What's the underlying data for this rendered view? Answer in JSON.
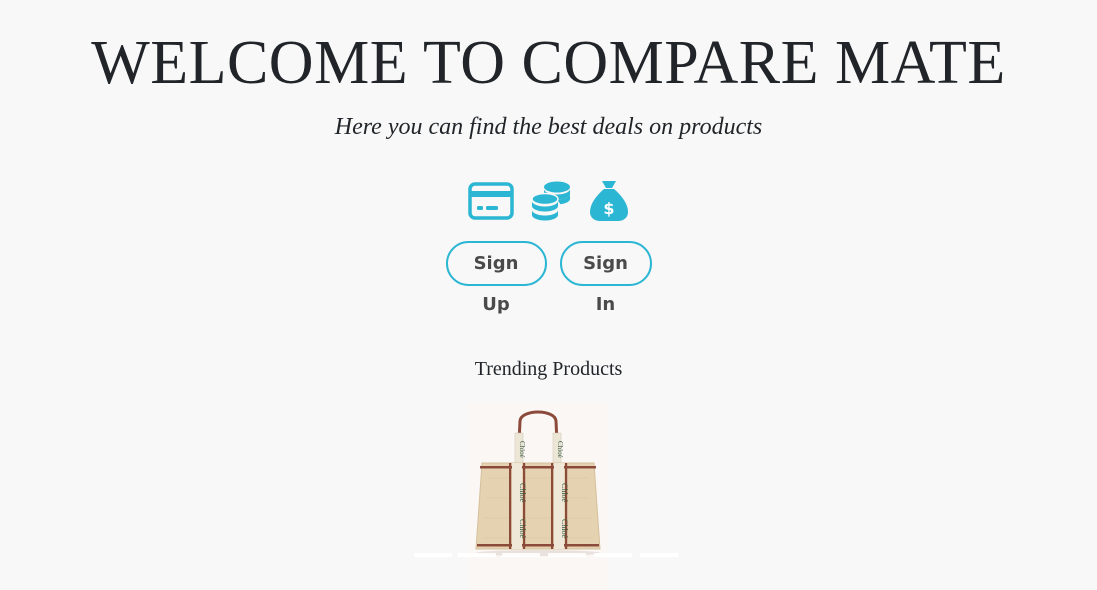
{
  "header": {
    "title": "WELCOME TO COMPARE MATE",
    "subtitle": "Here you can find the best deals on products"
  },
  "icons": [
    "credit-card-icon",
    "coins-icon",
    "money-bag-icon"
  ],
  "buttons": {
    "sign_up": "Sign Up",
    "sign_in": "Sign In"
  },
  "trending": {
    "heading": "Trending Products",
    "items": [
      {
        "image": "tote-bag",
        "brand_text": "Chloé"
      }
    ]
  },
  "colors": {
    "accent": "#2bb6d3",
    "background": "#f8f8f8",
    "text": "#212529",
    "button_text": "#4a4a4a"
  }
}
